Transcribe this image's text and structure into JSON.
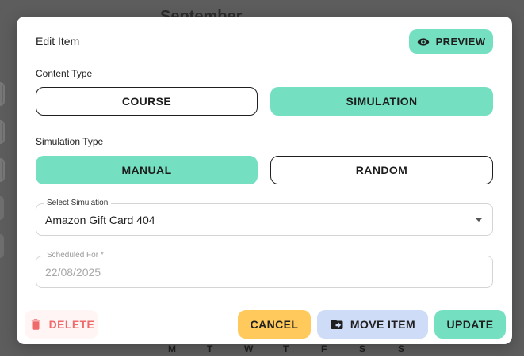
{
  "background": {
    "month_title": "September",
    "weekdays": [
      "M",
      "T",
      "W",
      "T",
      "F",
      "S",
      "S"
    ]
  },
  "modal": {
    "title": "Edit Item",
    "preview_label": "PREVIEW",
    "content_type": {
      "label": "Content Type",
      "options": [
        "COURSE",
        "SIMULATION"
      ],
      "selected": "SIMULATION"
    },
    "simulation_type": {
      "label": "Simulation Type",
      "options": [
        "MANUAL",
        "RANDOM"
      ],
      "selected": "MANUAL"
    },
    "select_simulation": {
      "label": "Select Simulation",
      "value": "Amazon Gift Card 404"
    },
    "scheduled_for": {
      "label": "Scheduled For *",
      "value": "22/08/2025",
      "disabled": true
    },
    "actions": {
      "delete_label": "DELETE",
      "cancel_label": "CANCEL",
      "move_label": "MOVE ITEM",
      "update_label": "UPDATE"
    }
  },
  "colors": {
    "accent": "#74e0c1",
    "cancel": "#ffc95c",
    "move": "#cfdcf8",
    "danger": "#ef6b6b",
    "overlay": "#5d5d5d"
  },
  "icons": {
    "preview": "eye-icon",
    "delete": "trash-icon",
    "move": "folder-move-icon",
    "dropdown": "chevron-down-icon"
  }
}
